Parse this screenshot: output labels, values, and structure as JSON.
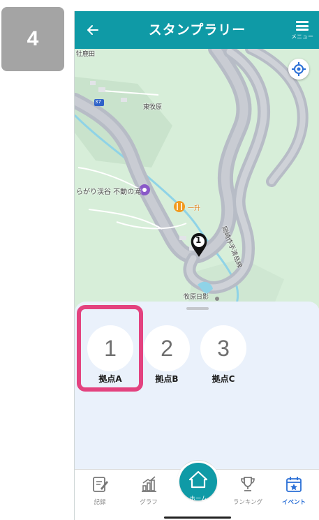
{
  "step_number": "4",
  "header": {
    "title": "スタンプラリー",
    "menu_label": "メニュー"
  },
  "map": {
    "labels": {
      "top_left": "牡鹿田",
      "higashi_makihara": "東牧原",
      "route_number": "37",
      "spot_name": "らがり渓谷 不動の滝",
      "restaurant": "一升",
      "road": "岡崎作手清岳線",
      "makihara_hikage": "牧原日影"
    },
    "marker_number": "1"
  },
  "stamps": [
    {
      "number": "1",
      "label": "拠点A"
    },
    {
      "number": "2",
      "label": "拠点B"
    },
    {
      "number": "3",
      "label": "拠点C"
    }
  ],
  "tabs": {
    "record": "記録",
    "graph": "グラフ",
    "home": "ホーム",
    "ranking": "ランキング",
    "event": "イベント"
  },
  "colors": {
    "header": "#0f9aa6",
    "highlight": "#e3427f",
    "sheet": "#eaf1fb",
    "active_tab": "#2a6fd6"
  }
}
